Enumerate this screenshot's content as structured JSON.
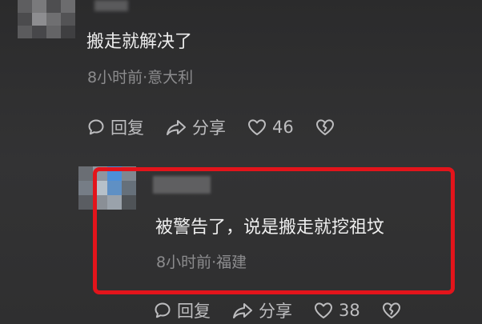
{
  "top_comment": {
    "text": "搬走就解决了",
    "meta": "8小时前·意大利",
    "actions": {
      "reply_label": "回复",
      "share_label": "分享",
      "like_count": "46"
    }
  },
  "reply_comment": {
    "text": "被警告了，说是搬走就挖祖坟",
    "meta": "8小时前·福建",
    "actions": {
      "reply_label": "回复",
      "share_label": "分享",
      "like_count": "38"
    }
  },
  "colors": {
    "background": "#2f2f30",
    "highlight_border": "#e3141b",
    "meta_text": "#8c8c8e"
  },
  "icons": {
    "reply": "comment-bubble-icon",
    "share": "share-arrow-icon",
    "like": "heart-icon",
    "dislike": "broken-heart-icon"
  }
}
